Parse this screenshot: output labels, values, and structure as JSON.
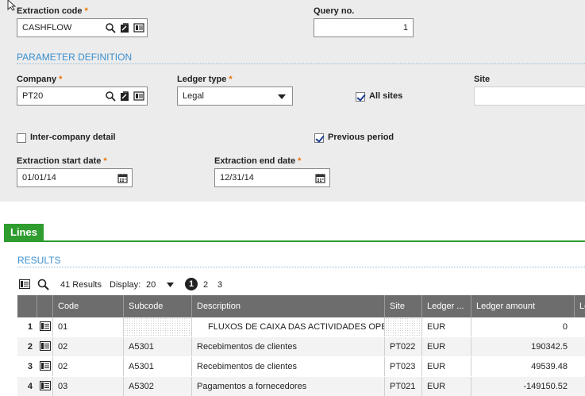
{
  "form": {
    "extraction_code": {
      "label": "Extraction code",
      "value": "CASHFLOW"
    },
    "query_no": {
      "label": "Query no.",
      "value": "1"
    },
    "section_title": "PARAMETER DEFINITION",
    "company": {
      "label": "Company",
      "value": "PT20"
    },
    "ledger_type": {
      "label": "Ledger type",
      "value": "Legal"
    },
    "all_sites": {
      "label": "All sites",
      "checked": true
    },
    "site": {
      "label": "Site",
      "value": ""
    },
    "intercompany": {
      "label": "Inter-company detail",
      "checked": false
    },
    "previous_period": {
      "label": "Previous period",
      "checked": true
    },
    "start_date": {
      "label": "Extraction start date",
      "value": "01/01/14"
    },
    "end_date": {
      "label": "Extraction end date",
      "value": "12/31/14"
    }
  },
  "tab": {
    "label": "Lines"
  },
  "results": {
    "title": "RESULTS",
    "count_text": "41 Results",
    "display_label": "Display:",
    "display_value": "20",
    "pages": [
      "1",
      "2",
      "3"
    ],
    "current_page": "1",
    "columns": [
      "Code",
      "Subcode",
      "Description",
      "Site",
      "Ledger ...",
      "Ledger amount",
      "Le"
    ],
    "rows": [
      {
        "num": "1",
        "code": "01",
        "subcode": "",
        "description": "FLUXOS DE CAIXA DAS ACTIVIDADES OPER",
        "site": "",
        "currency": "EUR",
        "amount": "0"
      },
      {
        "num": "2",
        "code": "02",
        "subcode": "A5301",
        "description": "Recebimentos de clientes",
        "site": "PT022",
        "currency": "EUR",
        "amount": "190342.5"
      },
      {
        "num": "3",
        "code": "02",
        "subcode": "A5301",
        "description": "Recebimentos de clientes",
        "site": "PT023",
        "currency": "EUR",
        "amount": "49539.48"
      },
      {
        "num": "4",
        "code": "03",
        "subcode": "A5302",
        "description": "Pagamentos a fornecedores",
        "site": "PT021",
        "currency": "EUR",
        "amount": "-149150.52"
      }
    ]
  },
  "colors": {
    "accent": "#3a8fd0",
    "tab_green": "#2e9c2e",
    "required": "#f07000",
    "grid_header": "#6d6d6d"
  }
}
